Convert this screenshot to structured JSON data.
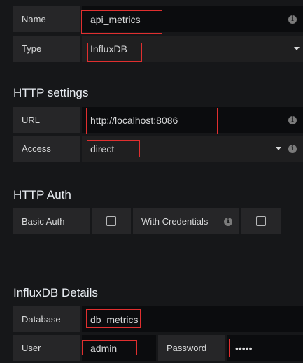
{
  "general": {
    "name_label": "Name",
    "name_value": "api_metrics",
    "type_label": "Type",
    "type_value": "InfluxDB"
  },
  "http_settings": {
    "title": "HTTP settings",
    "url_label": "URL",
    "url_value": "http://localhost:8086",
    "access_label": "Access",
    "access_value": "direct"
  },
  "http_auth": {
    "title": "HTTP Auth",
    "basic_auth_label": "Basic Auth",
    "basic_auth_checked": false,
    "with_credentials_label": "With Credentials",
    "with_credentials_checked": false
  },
  "influxdb_details": {
    "title": "InfluxDB Details",
    "database_label": "Database",
    "database_value": "db_metrics",
    "user_label": "User",
    "user_value": "admin",
    "password_label": "Password",
    "password_value": "•••••"
  },
  "icons": {
    "info": "info-icon",
    "dropdown": "caret-down-icon"
  },
  "colors": {
    "background": "#161719",
    "label_bg": "#262628",
    "field_bg": "#0b0c0e",
    "highlight": "#e02f2f"
  }
}
